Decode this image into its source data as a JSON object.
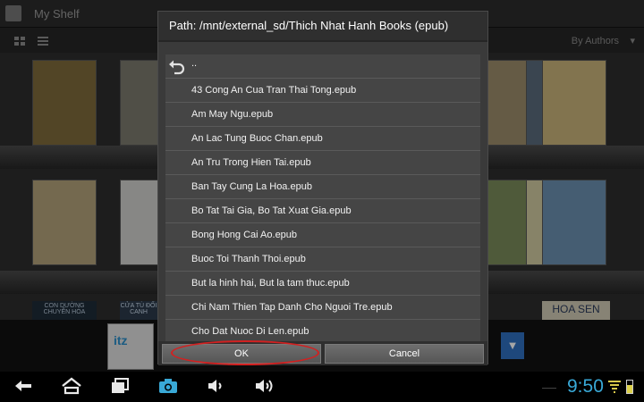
{
  "app": {
    "title": "My Shelf",
    "sort_label": "By Authors",
    "sort_chevron": "▾"
  },
  "bookshelf": {
    "book_colors": [
      "#7f6a3b",
      "#7c7a6e",
      "#8a6e3a",
      "#2b2b2b",
      "#5d5d5d",
      "#9c8c6b",
      "#5a6a7c",
      "#c8b27a",
      "#b2a27a",
      "#d0d0cc",
      "#3a3a3a",
      "#3c3c3c",
      "#595959",
      "#7a8a5a",
      "#cfc9a0",
      "#6a8fb0"
    ],
    "lower_labels": [
      "CON DƯỜNG CHUYỂN HÓA",
      "CỬA TÙ ĐỐI CANH",
      "HOA SEN"
    ]
  },
  "thumbnail_badge": "itz",
  "dialog": {
    "title": "Path: /mnt/external_sd/Thich Nhat Hanh Books (epub)",
    "up_label": "..",
    "files": [
      "43 Cong An Cua Tran Thai Tong.epub",
      "Am May Ngu.epub",
      "An Lac Tung Buoc Chan.epub",
      "An Tru Trong Hien Tai.epub",
      "Ban Tay Cung La Hoa.epub",
      "Bo Tat Tai Gia, Bo Tat Xuat Gia.epub",
      "Bong Hong Cai Ao.epub",
      "Buoc Toi Thanh Thoi.epub",
      "But la hinh hai, But la tam thuc.epub",
      "Chi Nam Thien Tap Danh Cho Nguoi Tre.epub",
      "Cho Dat Nuoc Di Len.epub"
    ],
    "ok_label": "OK",
    "cancel_label": "Cancel"
  },
  "statusbar": {
    "time": "9:50",
    "time_color": "#39a9d7",
    "highlight_color": "#d32020"
  }
}
